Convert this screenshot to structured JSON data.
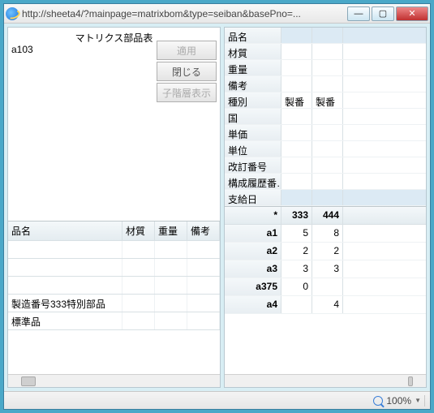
{
  "titlebar": {
    "url": "http://sheeta4/?mainpage=matrixbom&type=seiban&basePno=..."
  },
  "left": {
    "title": "マトリクス部品表",
    "code": "a103",
    "buttons": {
      "apply": "適用",
      "close": "閉じる",
      "child": "子階層表示"
    },
    "headers": {
      "name": "品名",
      "mat": "材質",
      "wt": "重量",
      "rem": "備考"
    },
    "rows": [
      {
        "name": ""
      },
      {
        "name": ""
      },
      {
        "name": ""
      },
      {
        "name": "製造番号333特別部品"
      },
      {
        "name": "標準品"
      }
    ]
  },
  "right": {
    "attrs": [
      {
        "label": "品名",
        "sel": true
      },
      {
        "label": "材質"
      },
      {
        "label": "重量"
      },
      {
        "label": "備考"
      },
      {
        "label": "種別",
        "cols": [
          "製番",
          "製番"
        ]
      },
      {
        "label": "国"
      },
      {
        "label": "単価"
      },
      {
        "label": "単位"
      },
      {
        "label": "改訂番号"
      },
      {
        "label": "構成履歴番…"
      },
      {
        "label": "支給日",
        "sel": true
      }
    ],
    "data_header": {
      "star": "*",
      "c1": "333",
      "c2": "444"
    },
    "data_rows": [
      {
        "label": "a1",
        "c1": "5",
        "c2": "8"
      },
      {
        "label": "a2",
        "c1": "2",
        "c2": "2"
      },
      {
        "label": "a3",
        "c1": "3",
        "c2": "3"
      },
      {
        "label": "a375",
        "c1": "0",
        "c2": ""
      },
      {
        "label": "a4",
        "c1": "",
        "c2": "4"
      }
    ]
  },
  "status": {
    "zoom": "100%"
  }
}
